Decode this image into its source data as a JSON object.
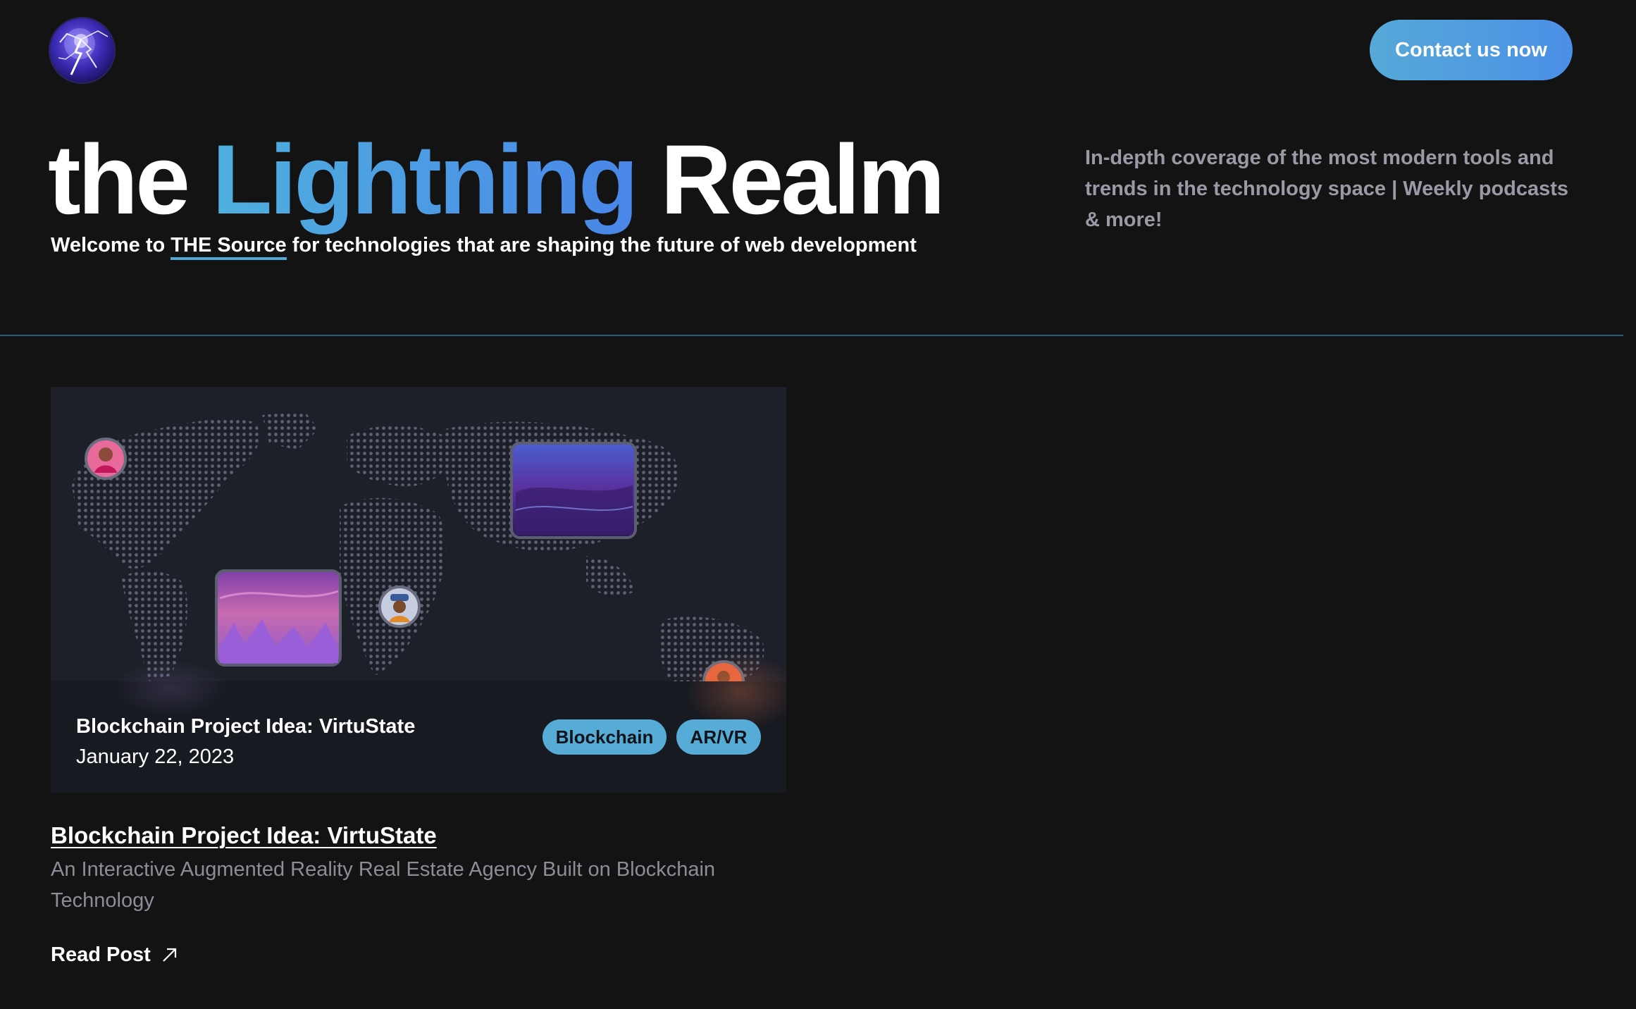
{
  "header": {
    "logo_icon": "lightning-orb-icon",
    "contact_button_label": "Contact us now"
  },
  "hero": {
    "title_part1": "the ",
    "title_highlight": "Lightning",
    "title_part2": " Realm",
    "subtitle_prefix": "Welcome to ",
    "subtitle_link": "THE Source",
    "subtitle_suffix": " for technologies that are shaping the future of web development",
    "tagline": "In-depth coverage of the most modern tools and trends in the technology space | Weekly podcasts & more!"
  },
  "colors": {
    "background": "#131313",
    "accent_start": "#4fb0de",
    "accent_end": "#4a86e8",
    "tag_background": "#56acd6",
    "muted_text": "#8d8d98"
  },
  "post": {
    "card_title": "Blockchain Project Idea: VirtuState",
    "card_date": "January 22, 2023",
    "tags": [
      "Blockchain",
      "AR/VR"
    ],
    "title": "Blockchain Project Idea: VirtuState",
    "description": "An Interactive Augmented Reality Real Estate Agency Built on Blockchain Technology",
    "read_label": "Read Post",
    "read_icon": "arrow-up-right-icon"
  }
}
